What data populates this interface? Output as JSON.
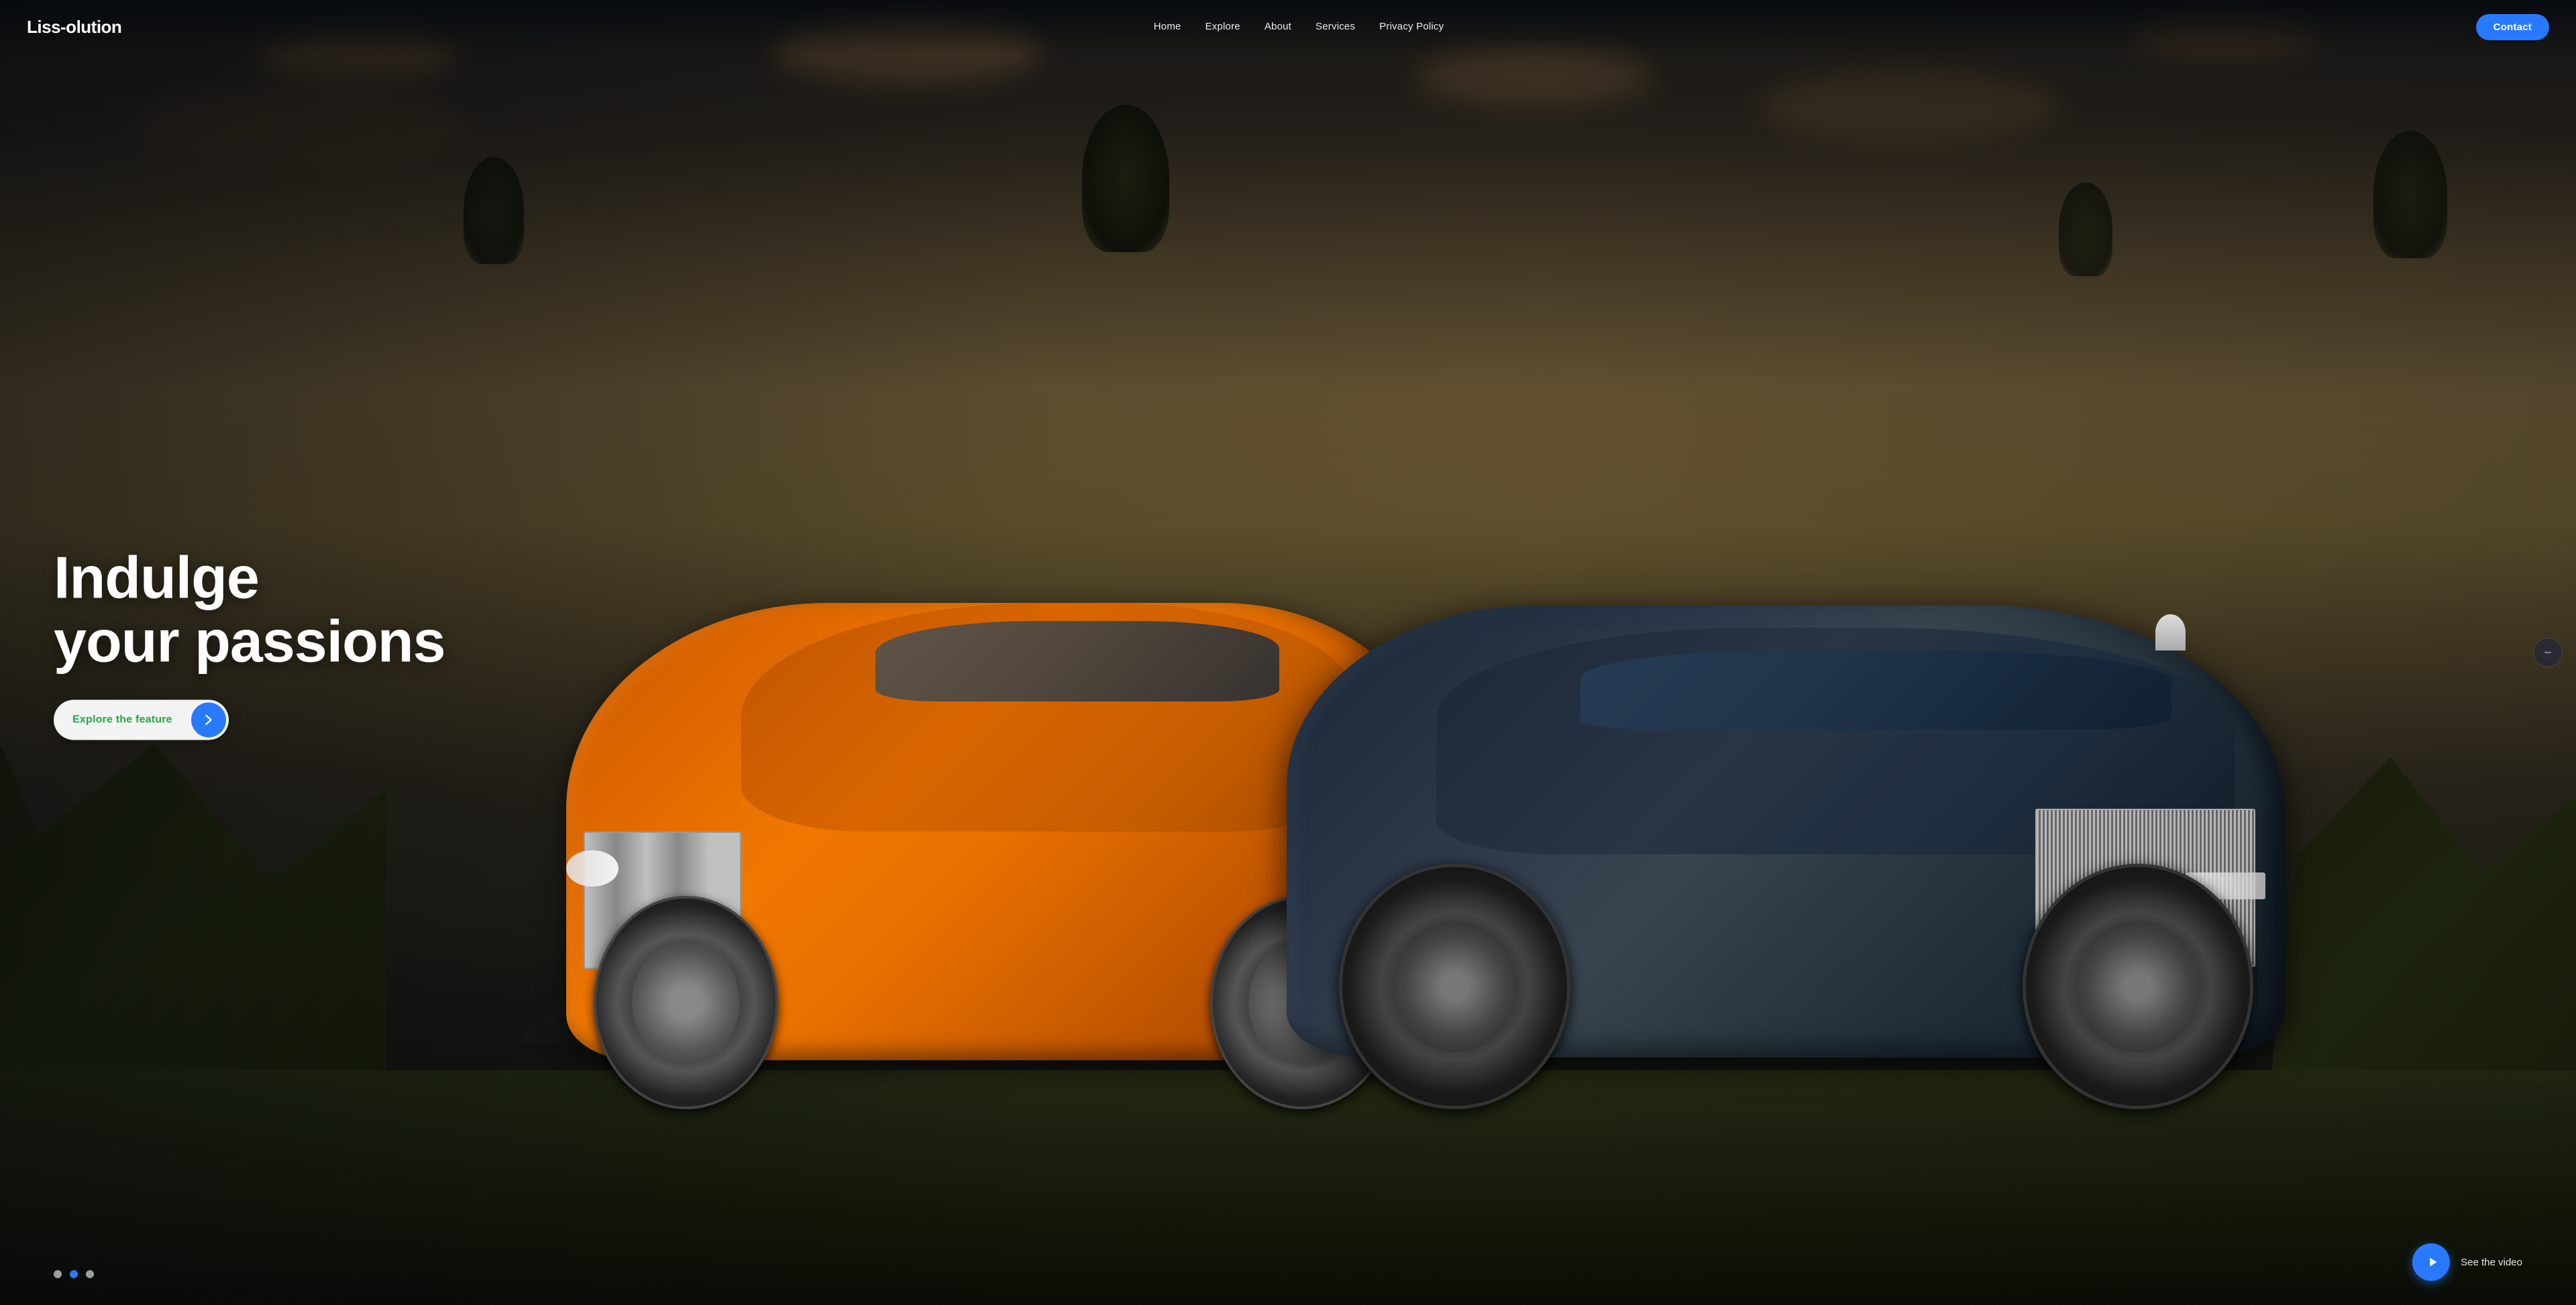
{
  "brand": {
    "logo": "Liss-olution"
  },
  "navbar": {
    "links": [
      {
        "id": "home",
        "label": "Home"
      },
      {
        "id": "explore",
        "label": "Explore"
      },
      {
        "id": "about",
        "label": "About"
      },
      {
        "id": "services",
        "label": "Services"
      },
      {
        "id": "privacy",
        "label": "Privacy Policy"
      }
    ],
    "contact_button": "Contact"
  },
  "hero": {
    "headline_line1": "Indulge",
    "headline_line2": "your passions",
    "cta_button": "Explore the feature",
    "slide_dots": [
      {
        "id": 1,
        "state": "inactive"
      },
      {
        "id": 2,
        "state": "active"
      },
      {
        "id": 3,
        "state": "inactive"
      }
    ],
    "video_label": "See the video"
  },
  "icons": {
    "arrow_right": "→",
    "play": "▶",
    "chat": "💬"
  },
  "colors": {
    "accent_blue": "#2979ff",
    "accent_green": "#22aa44",
    "bg_dark": "#080c10"
  }
}
